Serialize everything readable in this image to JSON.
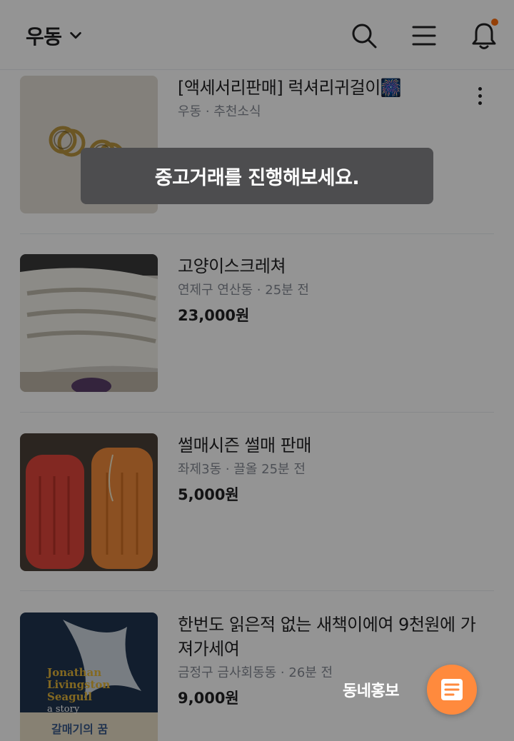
{
  "header": {
    "location": "우동",
    "icons": [
      "chevron-down-icon",
      "search-icon",
      "menu-icon",
      "bell-icon"
    ],
    "notification_dot_color": "#ff6f0f"
  },
  "items": [
    {
      "title": "[액세서리판매] 럭셔리귀걸이🎆",
      "meta": "우동 · 추천소식",
      "price": ""
    },
    {
      "title": "고양이스크레쳐",
      "meta": "연제구 연산동 · 25분 전",
      "price": "23,000원"
    },
    {
      "title": "썰매시즌 썰매 판매",
      "meta": "좌제3동 · 끌올 25분 전",
      "price": "5,000원"
    },
    {
      "title": "한번도 읽은적 없는 새책이에여 9천원에 가져가세여",
      "meta": "금정구 금사회동동 · 26분 전",
      "price": "9,000원"
    }
  ],
  "book_cover": {
    "title_en": "Jonathan Livingston Seagull",
    "subtitle_en": "a story",
    "title_ko": "갈매기의 꿈"
  },
  "toast": {
    "text": "중고거래를 진행해보세요."
  },
  "fab": {
    "label": "동네홍보",
    "color": "#ff8a3d"
  }
}
